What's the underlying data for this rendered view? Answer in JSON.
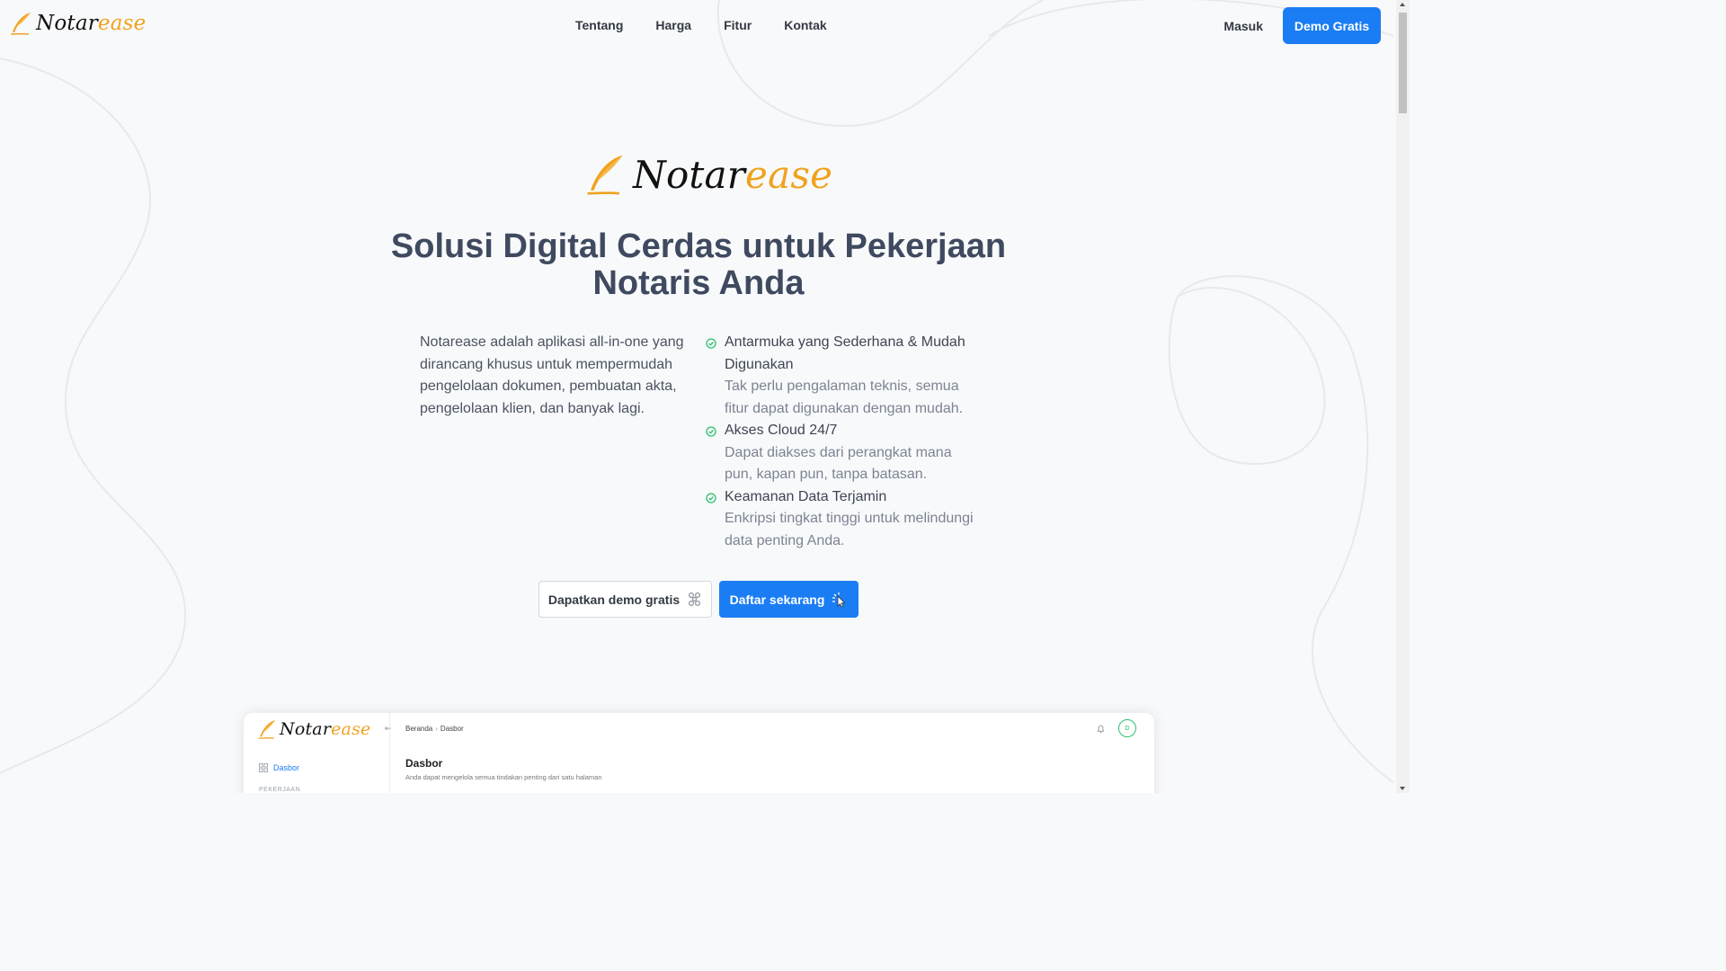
{
  "nav": {
    "brand_part1": "Notar",
    "brand_part2": "ease",
    "links": [
      "Tentang",
      "Harga",
      "Fitur",
      "Kontak"
    ],
    "login": "Masuk",
    "demo": "Demo Gratis"
  },
  "hero": {
    "logo_part1": "Notar",
    "logo_part2": "ease",
    "title": "Solusi Digital Cerdas untuk Pekerjaan Notaris Anda",
    "description": "Notarease adalah aplikasi all-in-one yang dirancang khusus untuk mempermudah pengelolaan dokumen, pembuatan akta, pengelolaan klien, dan banyak lagi.",
    "features": [
      {
        "title": "Antarmuka yang Sederhana & Mudah Digunakan",
        "desc": "Tak perlu pengalaman teknis, semua fitur dapat digunakan dengan mudah."
      },
      {
        "title": "Akses Cloud 24/7",
        "desc": "Dapat diakses dari perangkat mana pun, kapan pun, tanpa batasan."
      },
      {
        "title": "Keamanan Data Terjamin",
        "desc": "Enkripsi tingkat tinggi untuk melindungi data penting Anda."
      }
    ],
    "cta_secondary": "Dapatkan demo gratis",
    "cta_primary": "Daftar sekarang"
  },
  "preview": {
    "brand_part1": "Notar",
    "brand_part2": "ease",
    "collapse_icon": "⇤",
    "breadcrumb_home": "Beranda",
    "breadcrumb_sep": "›",
    "breadcrumb_current": "Dasbor",
    "menu_dasbor": "Dasbor",
    "section_label": "PEKERJAAN",
    "page_title": "Dasbor",
    "page_subtitle": "Anda dapat mengelola semua tindakan penting dari satu halaman",
    "avatar_initial": "D"
  },
  "colors": {
    "accent": "#1a7df4",
    "brand_orange": "#f0a21f",
    "check_green": "#2cc06c",
    "title": "#3f4a60"
  },
  "icons": {
    "brand": "quill-icon",
    "feature": "check-circle-icon",
    "cta_secondary": "flower-icon",
    "cta_primary": "pointer-click-icon"
  }
}
